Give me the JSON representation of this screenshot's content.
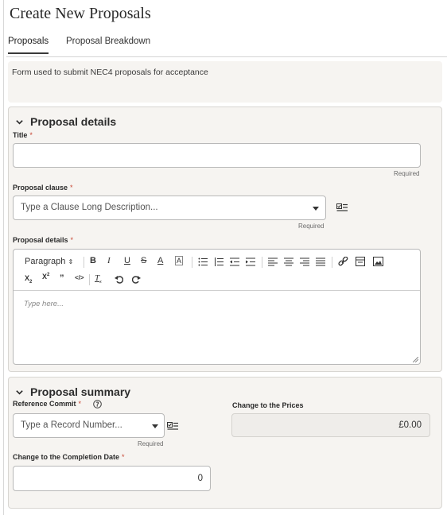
{
  "page": {
    "title": "Create New Proposals"
  },
  "tabs": [
    {
      "label": "Proposals",
      "active": true
    },
    {
      "label": "Proposal Breakdown",
      "active": false
    }
  ],
  "info": {
    "text": "Form used to submit NEC4 proposals for acceptance"
  },
  "proposal_details": {
    "header": "Proposal details",
    "title_label": "Title",
    "title_required": "*",
    "title_hint": "Required",
    "clause_label": "Proposal clause",
    "clause_required": "*",
    "clause_placeholder": "Type a Clause Long Description...",
    "clause_hint": "Required",
    "details_label": "Proposal details",
    "details_required": "*",
    "editor": {
      "format_select": "Paragraph",
      "placeholder": "Type here..."
    }
  },
  "proposal_summary": {
    "header": "Proposal summary",
    "ref_label": "Reference Commit",
    "ref_required": "*",
    "ref_placeholder": "Type a Record Number...",
    "ref_hint": "Required",
    "prices_label": "Change to the Prices",
    "prices_value": "£0.00",
    "completion_label": "Change to the Completion Date",
    "completion_required": "*",
    "completion_value": "0"
  },
  "colors": {
    "required": "#c74634",
    "panel_bg": "#f6f4f1",
    "tab_indicator": "#3a3a3a"
  }
}
